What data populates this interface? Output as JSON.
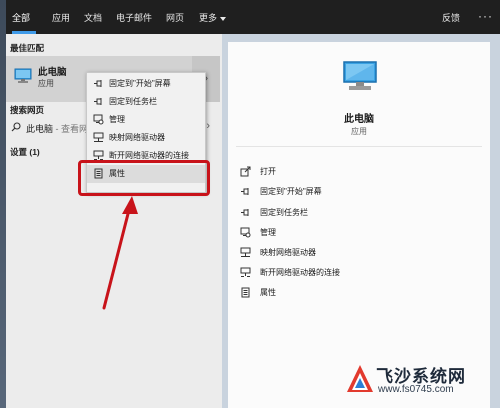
{
  "tabs": [
    {
      "label": "全部",
      "active": true
    },
    {
      "label": "应用"
    },
    {
      "label": "文档"
    },
    {
      "label": "电子邮件"
    },
    {
      "label": "网页"
    },
    {
      "label": "更多"
    }
  ],
  "topbar": {
    "feedback": "反馈",
    "more_options": "···"
  },
  "left": {
    "best_match_label": "最佳匹配",
    "best_match": {
      "title": "此电脑",
      "subtitle": "应用"
    },
    "search_web_label": "搜索网页",
    "web_result": {
      "text": "此电脑",
      "suffix": " - 查看网"
    },
    "settings_label": "设置 (1)"
  },
  "context_menu": [
    {
      "label": "固定到\"开始\"屏幕",
      "icon": "pin-icon"
    },
    {
      "label": "固定到任务栏",
      "icon": "pin-icon"
    },
    {
      "label": "管理",
      "icon": "manage-icon"
    },
    {
      "label": "映射网络驱动器",
      "icon": "network-drive-icon"
    },
    {
      "label": "断开网络驱动器的连接",
      "icon": "disconnect-drive-icon"
    },
    {
      "label": "属性",
      "icon": "properties-icon",
      "highlighted": true
    }
  ],
  "right": {
    "title": "此电脑",
    "subtitle": "应用",
    "actions": [
      {
        "label": "打开",
        "icon": "open-icon"
      },
      {
        "label": "固定到\"开始\"屏幕",
        "icon": "pin-icon"
      },
      {
        "label": "固定到任务栏",
        "icon": "pin-icon"
      },
      {
        "label": "管理",
        "icon": "manage-icon"
      },
      {
        "label": "映射网络驱动器",
        "icon": "network-drive-icon"
      },
      {
        "label": "断开网络驱动器的连接",
        "icon": "disconnect-drive-icon"
      },
      {
        "label": "属性",
        "icon": "properties-icon"
      }
    ]
  },
  "watermark": {
    "name": "飞沙系统网",
    "url": "www.fs0745.com"
  },
  "colors": {
    "accent": "#3f9ae8",
    "annotation": "#c8131a",
    "topbar": "#1f1f1f"
  }
}
